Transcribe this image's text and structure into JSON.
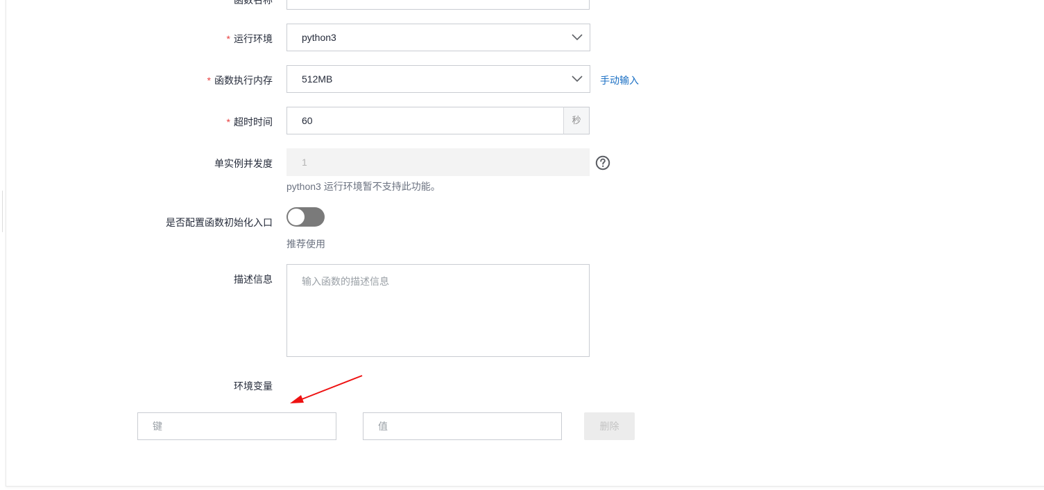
{
  "form": {
    "top_partial_label": "函数名称",
    "runtime": {
      "label": "运行环境",
      "value": "python3"
    },
    "memory": {
      "label": "函数执行内存",
      "value": "512MB",
      "manual_link": "手动输入"
    },
    "timeout": {
      "label": "超时时间",
      "value": "60",
      "unit": "秒"
    },
    "concurrency": {
      "label": "单实例并发度",
      "value": "1",
      "note": "python3 运行环境暂不支持此功能。"
    },
    "init_entry": {
      "label": "是否配置函数初始化入口",
      "hint": "推荐使用",
      "enabled": false
    },
    "description": {
      "label": "描述信息",
      "placeholder": "输入函数的描述信息"
    },
    "env_vars": {
      "label": "环境变量",
      "key_placeholder": "键",
      "value_placeholder": "值",
      "delete_label": "删除"
    }
  },
  "colors": {
    "required": "#e84040",
    "link": "#1a6fc4",
    "toggle_off": "#7a7a7a",
    "annotation_arrow": "#ee1111"
  },
  "icons": {
    "dropdown": "chevron-down-icon",
    "help": "question-circle-icon",
    "annotation": "red-arrow-annotation"
  }
}
